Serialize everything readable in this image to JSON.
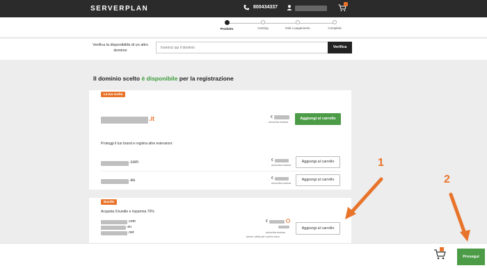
{
  "header": {
    "logo_server": "SERVER",
    "logo_plan": "PLAN",
    "phone": "800434337",
    "cart_count": "1"
  },
  "stepper": {
    "steps": [
      {
        "label": "Prodotto",
        "active": true
      },
      {
        "label": "Hosting",
        "active": false
      },
      {
        "label": "Dati e pagamento",
        "active": false
      },
      {
        "label": "Completa",
        "active": false
      }
    ]
  },
  "search": {
    "label": "Verifica la disponibilità di un altro dominio",
    "placeholder": "Inserisci qui il dominio",
    "button": "Verifica"
  },
  "result": {
    "heading_pre": "Il dominio scelto ",
    "heading_highlight": "è disponibile",
    "heading_post": " per la registrazione"
  },
  "main_card": {
    "tag": "La tua scelta",
    "tld": ".it",
    "price_currency": "€",
    "price_note": "annuo/iva esclusa",
    "add_button": "Aggiungi al carrello",
    "protect_text": "Proteggi il tuo brand e registra altre estensioni:",
    "extensions": [
      {
        "tld": ".com",
        "currency": "€",
        "note": "annuo/iva esclusa",
        "button": "Aggiungi al carrello"
      },
      {
        "tld": ".eu",
        "currency": "€",
        "note": "annuo/iva esclusa",
        "button": "Aggiungi al carrello"
      }
    ]
  },
  "bundle_card": {
    "tag": "Bundle",
    "title": "Acquista il bundle e risparmia 70%",
    "tlds": [
      ".com",
      ".eu",
      ".net"
    ],
    "currency": "€",
    "note": "annuo/iva esclusa",
    "note2": "prezzo valido per il primo anno",
    "button": "Aggiungi al carrello"
  },
  "footer": {
    "next_button": "Prosegui"
  },
  "annotations": {
    "first": "1",
    "second": "2"
  },
  "colors": {
    "accent": "#e8742b",
    "green": "#4c9b47",
    "topbar": "#2b2b2b"
  }
}
